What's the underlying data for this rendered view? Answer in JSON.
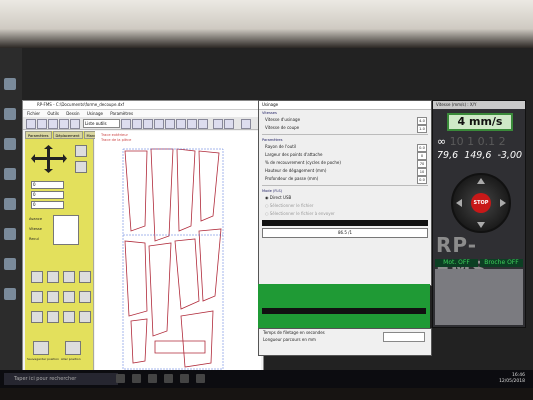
{
  "app": {
    "title": "RP-FMS - C:\\Documents\\forme_decoupe.dxf",
    "menu": [
      "Fichier",
      "Outils",
      "Dessin",
      "Usinage",
      "Paramètres"
    ],
    "tool_select": "Liste outils",
    "side_tabs": [
      "Paramètres",
      "Déplacement",
      "Manuel"
    ],
    "side_fields": [
      "0",
      "0",
      "0"
    ],
    "side_labels": [
      "Avance",
      "Vitesse",
      "Recul"
    ],
    "side_bottom_labels": [
      "Sauvegarder position",
      "Aller position"
    ],
    "canvas_labels": [
      "Trace extérieur",
      "Trace de la pièce"
    ]
  },
  "dialog": {
    "title": "Usinage",
    "group1": "Vitesses",
    "speed_rows": [
      {
        "label": "Vitesse d'usinage",
        "value": "4.0"
      },
      {
        "label": "Vitesse de coupe",
        "value": "1.0"
      }
    ],
    "group2": "Paramètres",
    "param_rows": [
      {
        "label": "Rayon de l'outil",
        "value": "0.0"
      },
      {
        "label": "Largeur des points d'attache",
        "value": "0"
      },
      {
        "label": "% de recouvrement (cycles de poche)",
        "value": "70"
      },
      {
        "label": "Hauteur de dégagement (mm)",
        "value": "10"
      },
      {
        "label": "Profondeur de passe (mm)",
        "value": "0.0"
      }
    ],
    "group3": "Mode (FLS)",
    "radios": [
      "Direct USB",
      "Sélectionner le fichier",
      "Sélectionner le fichier à envoyer"
    ],
    "progress_text": "86.5 /1",
    "bottom_labels": [
      "Temps de filetage en secondes",
      "Longueur parcours en mm"
    ]
  },
  "rpanel": {
    "title": "Vitesse (mm/s) : X/Y",
    "speed": "4 mm/s",
    "speed_levels": [
      "∞",
      "10",
      "1",
      "0.1",
      "2"
    ],
    "coords": [
      "79,6",
      "149,6",
      "-3,00"
    ],
    "stop_label": "STOP",
    "brand": "RP-FMS",
    "status": [
      "Mot. OFF",
      "Broche OFF"
    ]
  },
  "taskbar": {
    "search_placeholder": "Taper ici pour rechercher",
    "time": "16:46",
    "date": "12/05/2018"
  },
  "colors": {
    "side_panel": "#e3e05c",
    "green_panel": "#1f9a35",
    "speed_box": "#cfe9c8",
    "stop": "#c81818",
    "status_text": "#3ecf5b"
  }
}
